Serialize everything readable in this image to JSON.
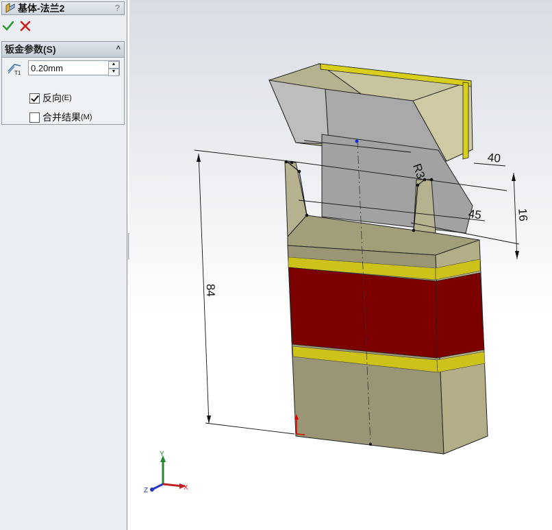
{
  "panel": {
    "title": "基体-法兰2",
    "help": "?",
    "group_title": "钣金参数(S)",
    "thickness": {
      "value": "0.20mm",
      "icon": "thickness-T1-icon",
      "icon_label": "T1"
    },
    "reverse": {
      "label": "反向",
      "accel": "(E)",
      "checked": true
    },
    "merge": {
      "label": "合并结果",
      "accel": "(M)",
      "checked": false
    }
  },
  "dimensions": {
    "height": "84",
    "width": "40",
    "depth": "16",
    "angle": "45",
    "radius": "R3"
  },
  "triad": {
    "x": "X",
    "y": "Y",
    "z": "Z"
  },
  "colors": {
    "ok": "#2e9b2e",
    "cancel": "#d01c1c",
    "panel_bg": "#eaeef2",
    "body": "#a7a27a",
    "red_band": "#7d0000",
    "gold_band": "#c9c000"
  }
}
